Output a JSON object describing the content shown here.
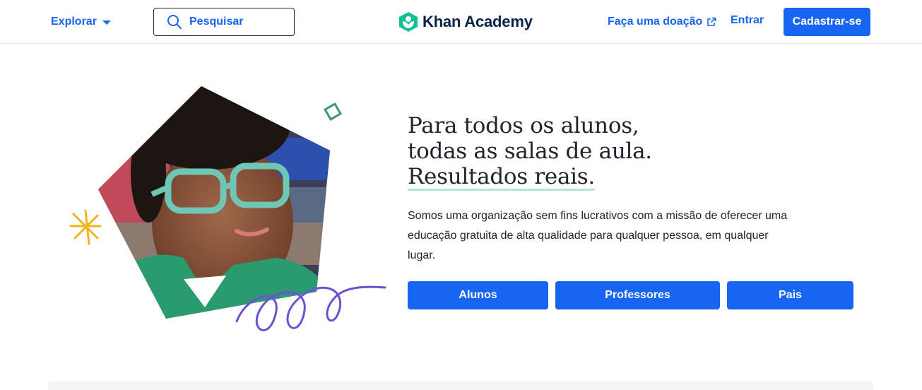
{
  "header": {
    "explore_label": "Explorar",
    "search_label": "Pesquisar",
    "brand_name": "Khan Academy",
    "donate_label": "Faça uma doação",
    "login_label": "Entrar",
    "signup_label": "Cadastrar-se"
  },
  "hero": {
    "headline_line1": "Para todos os alunos,",
    "headline_line2": "todas as salas de aula.",
    "headline_line3": "Resultados reais.",
    "description": "Somos uma organização sem fins lucrativos com a missão de oferecer uma educação gratuita de alta qualidade para qualquer pessoa, em qualquer lugar.",
    "buttons": {
      "students": "Alunos",
      "teachers": "Professores",
      "parents": "Pais"
    }
  },
  "colors": {
    "accent": "#1865f2",
    "brand_green": "#14bf96",
    "text": "#21242c",
    "underline": "#b8e3d4"
  },
  "icons": [
    "chevron-down-icon",
    "search-icon",
    "khan-logo-icon",
    "external-link-icon"
  ]
}
